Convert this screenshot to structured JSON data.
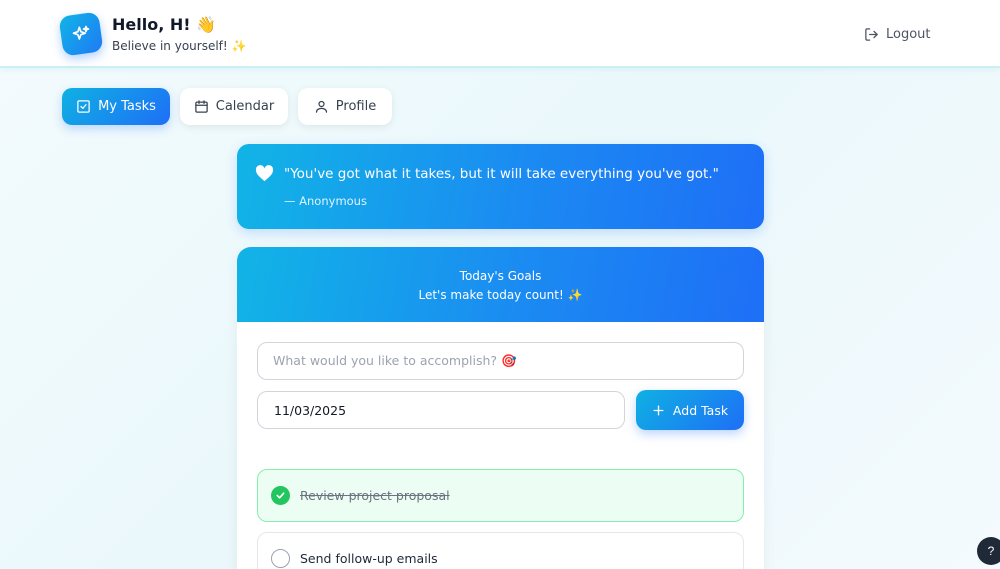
{
  "header": {
    "greeting": "Hello, H! 👋",
    "subtitle": "Believe in yourself! ✨",
    "logout_label": "Logout"
  },
  "nav": {
    "tabs": [
      {
        "label": "My Tasks",
        "icon": "checkbox-icon",
        "active": true
      },
      {
        "label": "Calendar",
        "icon": "calendar-icon",
        "active": false
      },
      {
        "label": "Profile",
        "icon": "user-icon",
        "active": false
      }
    ]
  },
  "quote": {
    "text": "\"You've got what it takes, but it will take everything you've got.\"",
    "author": "— Anonymous"
  },
  "goals": {
    "title": "Today's Goals",
    "subtitle": "Let's make today count! ✨",
    "task_placeholder": "What would you like to accomplish? 🎯",
    "date_value": "11/03/2025",
    "add_label": "Add Task"
  },
  "tasks": [
    {
      "label": "Review project proposal",
      "completed": true
    },
    {
      "label": "Send follow-up emails",
      "completed": false
    }
  ],
  "help_label": "?",
  "colors": {
    "accent_start": "#11b4e6",
    "accent_end": "#1e6ff6",
    "success": "#22c55e"
  }
}
